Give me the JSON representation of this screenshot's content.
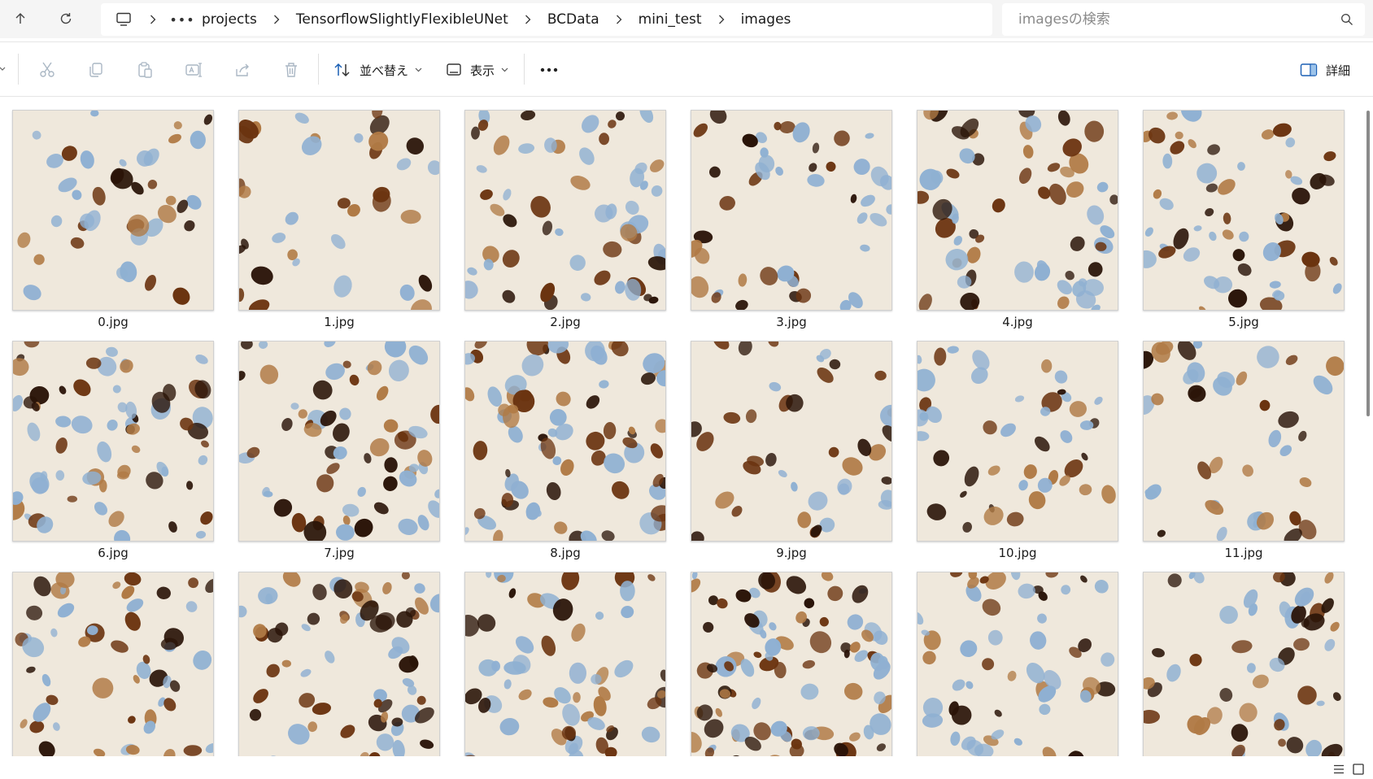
{
  "address_bar": {
    "breadcrumb": [
      "projects",
      "TensorflowSlightlyFlexibleUNet",
      "BCData",
      "mini_test",
      "images"
    ],
    "search_placeholder": "imagesの検索"
  },
  "command_bar": {
    "sort_label": "並べ替え",
    "view_label": "表示",
    "details_label": "詳細",
    "icons": [
      "cut-icon",
      "copy-icon",
      "paste-icon",
      "rename-icon",
      "share-icon",
      "delete-icon"
    ]
  },
  "files": [
    {
      "name": "0.jpg"
    },
    {
      "name": "1.jpg"
    },
    {
      "name": "2.jpg"
    },
    {
      "name": "3.jpg"
    },
    {
      "name": "4.jpg"
    },
    {
      "name": "5.jpg"
    },
    {
      "name": "6.jpg"
    },
    {
      "name": "7.jpg"
    },
    {
      "name": "8.jpg"
    },
    {
      "name": "9.jpg"
    },
    {
      "name": "10.jpg"
    },
    {
      "name": "11.jpg"
    },
    {
      "name": ""
    },
    {
      "name": ""
    },
    {
      "name": ""
    },
    {
      "name": ""
    },
    {
      "name": ""
    },
    {
      "name": ""
    }
  ],
  "colors": {
    "nucleus_dark": "#2a1408",
    "nucleus_brown": "#6b3410",
    "nucleus_light": "#b07a45",
    "nucleus_blue": "#8fb0d2",
    "tissue_bg": "#efe8dc"
  }
}
